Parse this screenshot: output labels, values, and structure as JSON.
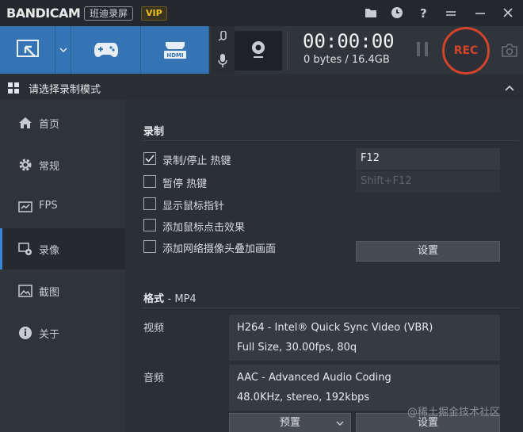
{
  "app": {
    "logo_main": "BANDI",
    "logo_cam": "CAM",
    "edition": "班迪录屏",
    "vip": "VIP"
  },
  "titlebar_icons": [
    "folder-icon",
    "clock-icon",
    "help-icon",
    "settings-icon",
    "minimize-icon",
    "close-icon"
  ],
  "toolbar": {
    "modes": [
      "screen-record-mode",
      "game-record-mode",
      "hdmi-record-mode"
    ],
    "hdmi_badge": "HDMI",
    "timer": "00:00:00",
    "size": "0 bytes / 16.4GB",
    "rec_label": "REC"
  },
  "modebar": {
    "label": "请选择录制模式"
  },
  "sidebar": {
    "items": [
      {
        "label": "首页",
        "icon": "home-icon"
      },
      {
        "label": "常规",
        "icon": "gear-icon"
      },
      {
        "label": "FPS",
        "icon": "fps-icon"
      },
      {
        "label": "录像",
        "icon": "video-settings-icon",
        "active": true
      },
      {
        "label": "截图",
        "icon": "image-icon"
      },
      {
        "label": "关于",
        "icon": "info-icon"
      }
    ]
  },
  "record": {
    "title": "录制",
    "options": [
      {
        "label": "录制/停止 热键",
        "checked": true
      },
      {
        "label": "暂停 热键",
        "checked": false
      },
      {
        "label": "显示鼠标指针",
        "checked": false
      },
      {
        "label": "添加鼠标点击效果",
        "checked": false
      },
      {
        "label": "添加网络摄像头叠加画面",
        "checked": false
      }
    ],
    "hotkey_record": "F12",
    "hotkey_pause": "Shift+F12",
    "settings_button": "设置"
  },
  "format": {
    "title": "格式",
    "format_sub": "- MP4",
    "video_label": "视频",
    "video_line1": "H264 - Intel® Quick Sync Video (VBR)",
    "video_line2": "Full Size, 30.00fps, 80q",
    "audio_label": "音频",
    "audio_line1": "AAC - Advanced Audio Coding",
    "audio_line2": "48.0KHz, stereo, 192kbps",
    "preset_button": "预置",
    "settings_button": "设置"
  },
  "watermark": "@稀土掘金技术社区",
  "colors": {
    "accent_blue": "#3474b4",
    "rec_red": "#d2442c",
    "vip_gold": "#f0c020",
    "background": "#2b2f36"
  }
}
